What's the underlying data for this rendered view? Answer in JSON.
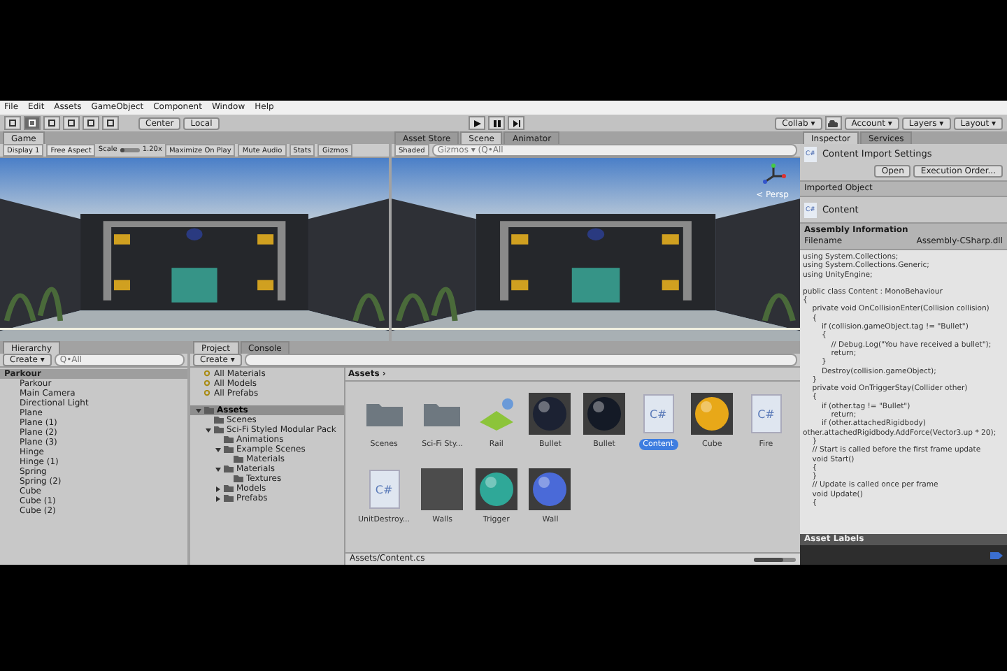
{
  "menu": [
    "File",
    "Edit",
    "Assets",
    "GameObject",
    "Component",
    "Window",
    "Help"
  ],
  "toolbar": {
    "pivot": [
      {
        "label": "Center"
      },
      {
        "label": "Local"
      }
    ],
    "right": [
      {
        "label": "Collab ▾"
      },
      {
        "label": "Account ▾"
      },
      {
        "label": "Layers ▾"
      },
      {
        "label": "Layout ▾"
      }
    ]
  },
  "game": {
    "tabs": [
      {
        "label": "Game",
        "selected": true
      }
    ],
    "display": "Display 1",
    "aspect": "Free Aspect",
    "scale_label": "Scale",
    "scale_slider": {
      "level": 0.2
    },
    "scale_value": "1.20x",
    "toggles": [
      {
        "label": "Maximize On Play",
        "on": false
      },
      {
        "label": "Mute Audio",
        "on": false
      },
      {
        "label": "Stats",
        "on": false
      },
      {
        "label": "Gizmos",
        "on": false
      }
    ]
  },
  "scene": {
    "tabs": [
      {
        "label": "Asset Store",
        "selected": false
      },
      {
        "label": "Scene",
        "selected": true
      },
      {
        "label": "Animator",
        "selected": false
      }
    ],
    "shading": "Shaded",
    "search_placeholder": "Gizmos ▾ (Q•All",
    "persp": "< Persp"
  },
  "hierarchy": {
    "tab": "Hierarchy",
    "create": "Create ▾",
    "search_placeholder": "Q•All",
    "scene": "Parkour",
    "items": [
      {
        "label": "Parkour",
        "selected": false
      },
      {
        "label": "Main Camera",
        "selected": false
      },
      {
        "label": "Directional Light",
        "selected": false
      },
      {
        "label": "Plane",
        "selected": false
      },
      {
        "label": "Plane (1)",
        "selected": false
      },
      {
        "label": "Plane (2)",
        "selected": false
      },
      {
        "label": "Plane (3)",
        "selected": false
      },
      {
        "label": "Hinge",
        "selected": false
      },
      {
        "label": "Hinge (1)",
        "selected": false
      },
      {
        "label": "Spring",
        "selected": false
      },
      {
        "label": "Spring (2)",
        "selected": false
      },
      {
        "label": "Cube",
        "selected": false
      },
      {
        "label": "Cube (1)",
        "selected": false
      },
      {
        "label": "Cube (2)",
        "selected": false
      }
    ]
  },
  "project": {
    "tabs": [
      {
        "label": "Project",
        "selected": true
      },
      {
        "label": "Console",
        "selected": false
      }
    ],
    "create": "Create ▾",
    "favorites": [
      "All Materials",
      "All Models",
      "All Prefabs"
    ],
    "tree": {
      "label": "Assets",
      "selected": true,
      "expanded": true,
      "children": [
        {
          "label": "Scenes",
          "selected": false
        },
        {
          "label": "Sci-Fi Styled Modular Pack",
          "selected": false,
          "expanded": true,
          "children": [
            {
              "label": "Animations",
              "selected": false
            },
            {
              "label": "Example Scenes",
              "selected": false,
              "expanded": true,
              "children": [
                {
                  "label": "Materials",
                  "selected": false
                }
              ]
            },
            {
              "label": "Materials",
              "selected": false,
              "expanded": true,
              "children": [
                {
                  "label": "Textures",
                  "selected": false
                }
              ]
            },
            {
              "label": "Models",
              "selected": false,
              "expanded": false
            },
            {
              "label": "Prefabs",
              "selected": false,
              "expanded": false
            }
          ]
        }
      ]
    }
  },
  "assets": {
    "breadcrumb": "Assets ›",
    "path": "Assets/Content.cs",
    "zoom_slider": {
      "level": 0.7
    },
    "items": [
      {
        "label": "Scenes",
        "kind": "folder",
        "selected": false
      },
      {
        "label": "Sci-Fi Sty...",
        "kind": "folder",
        "selected": false
      },
      {
        "label": "Rail",
        "kind": "prefab",
        "selected": false
      },
      {
        "label": "Bullet",
        "kind": "material",
        "color": "#1c2233",
        "selected": false
      },
      {
        "label": "Bullet",
        "kind": "material",
        "color": "#141a26",
        "selected": false
      },
      {
        "label": "Content",
        "kind": "script",
        "badge": "C#",
        "selected": true
      },
      {
        "label": "Cube",
        "kind": "material",
        "color": "#e8a818",
        "selected": false
      },
      {
        "label": "Fire",
        "kind": "script",
        "badge": "C#",
        "selected": false
      },
      {
        "label": "UnitDestroy...",
        "kind": "script",
        "badge": "C#",
        "selected": false
      },
      {
        "label": "Walls",
        "kind": "texture",
        "selected": false
      },
      {
        "label": "Trigger",
        "kind": "material",
        "color": "#2fa898",
        "selected": false
      },
      {
        "label": "Wall",
        "kind": "material",
        "color": "#4a6ad8",
        "selected": false
      }
    ]
  },
  "inspector": {
    "tabs": [
      {
        "label": "Inspector",
        "selected": true
      },
      {
        "label": "Services",
        "selected": false
      }
    ],
    "title_badge": "C#",
    "title": "Content Import Settings",
    "buttons": [
      "Open",
      "Execution Order..."
    ],
    "imported_object": "Imported Object",
    "object_badge": "C#",
    "object_name": "Content",
    "assembly_title": "Assembly Information",
    "filename_label": "Filename",
    "filename_value": "Assembly-CSharp.dll",
    "code_blocks": [
      [
        "using System.Collections;",
        "using System.Collections.Generic;",
        "using UnityEngine;"
      ],
      [
        "public class Content : MonoBehaviour",
        "{",
        "    private void OnCollisionEnter(Collision collision)",
        "    {",
        "        if (collision.gameObject.tag != \"Bullet\")",
        "        {",
        "            // Debug.Log(\"You have received a bullet\");",
        "            return;",
        "        }",
        "        Destroy(collision.gameObject);",
        "    }",
        "    private void OnTriggerStay(Collider other)",
        "    {",
        "        if (other.tag != \"Bullet\")",
        "            return;",
        "        if (other.attachedRigidbody)",
        "other.attachedRigidbody.AddForce(Vector3.up * 20);",
        "    }",
        "    // Start is called before the first frame update",
        "    void Start()",
        "    {",
        "    }",
        "    // Update is called once per frame",
        "    void Update()",
        "    {"
      ]
    ],
    "labels_title": "Asset Labels"
  }
}
